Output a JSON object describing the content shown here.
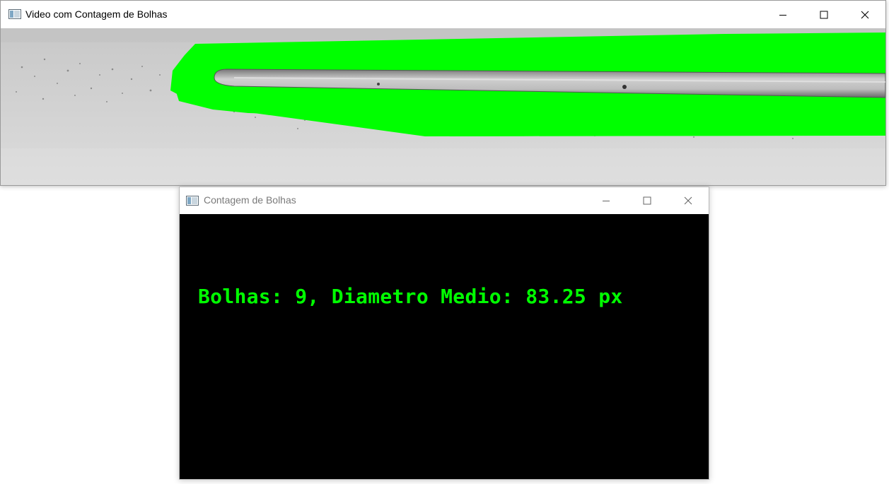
{
  "windows": {
    "video": {
      "title": "Video com Contagem de Bolhas",
      "controls": [
        "minimize-icon",
        "maximize-icon",
        "close-icon"
      ]
    },
    "count": {
      "title": "Contagem de Bolhas",
      "controls": [
        "minimize-icon",
        "maximize-icon",
        "close-icon"
      ],
      "overlay_text": "Bolhas: 9, Diametro Medio: 83.25 px"
    }
  },
  "colors": {
    "overlay_green": "#00ff00",
    "canvas_background": "#000000",
    "inactive_title": "#7a7a7a"
  }
}
